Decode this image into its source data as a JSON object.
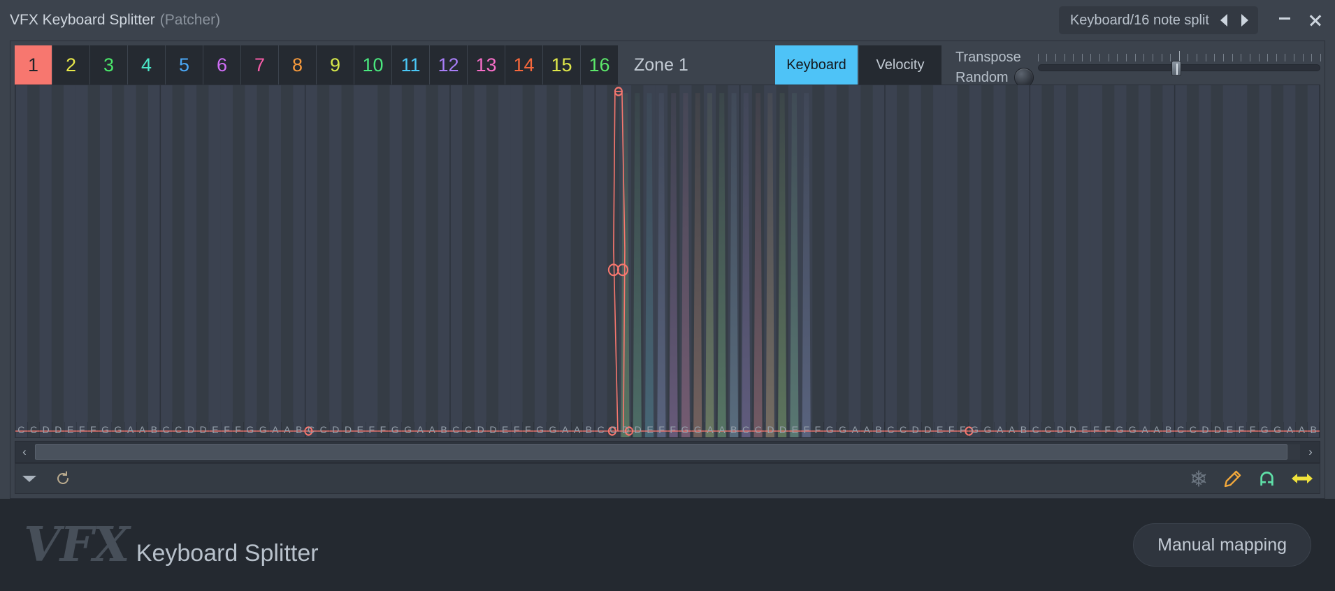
{
  "window": {
    "title": "VFX Keyboard Splitter",
    "title_suffix": "(Patcher)",
    "preset_name": "Keyboard/16 note split",
    "prev_preset_label": "◀",
    "next_preset_label": "▶",
    "minimize_label": "–",
    "close_label": "✕"
  },
  "zones": {
    "label": "Zone 1",
    "active_index": 0,
    "tabs": [
      {
        "label": "1",
        "color": "#20242a"
      },
      {
        "label": "2",
        "color": "#e8e84a"
      },
      {
        "label": "3",
        "color": "#4ae86a"
      },
      {
        "label": "4",
        "color": "#4ae8c8"
      },
      {
        "label": "5",
        "color": "#4aa8f7"
      },
      {
        "label": "6",
        "color": "#d06ef7"
      },
      {
        "label": "7",
        "color": "#f75ca8"
      },
      {
        "label": "8",
        "color": "#f79a3c"
      },
      {
        "label": "9",
        "color": "#d6e84a"
      },
      {
        "label": "10",
        "color": "#4ae87e"
      },
      {
        "label": "11",
        "color": "#4ac8f7"
      },
      {
        "label": "12",
        "color": "#a87ef7"
      },
      {
        "label": "13",
        "color": "#f76ec8"
      },
      {
        "label": "14",
        "color": "#f7683c"
      },
      {
        "label": "15",
        "color": "#e0e84a"
      },
      {
        "label": "16",
        "color": "#5ce86a"
      }
    ]
  },
  "mode": {
    "keyboard_label": "Keyboard",
    "velocity_label": "Velocity",
    "active": "Keyboard",
    "active_color": "#4ec3f7"
  },
  "transpose": {
    "label": "Transpose",
    "random_label": "Random",
    "slider_value_pct": 49,
    "tick_count": 33,
    "major_tick_index": 16
  },
  "grid": {
    "note_labels": [
      "C",
      "C",
      "D",
      "D",
      "E",
      "F",
      "F",
      "G",
      "G",
      "A",
      "A",
      "B"
    ],
    "octave_count": 9,
    "envelope_color": "#f7776f",
    "background_color": "#39404a",
    "zone_band_colors": [
      "#6e9a6e",
      "#5e8f7e",
      "#4f8090",
      "#6e7a9e",
      "#8a6e9e",
      "#9e6e8a",
      "#9e7a6e",
      "#8a9e6e",
      "#6e9e7a",
      "#6e8a9e",
      "#7a6e9e",
      "#9e6e7a",
      "#9e8a6e",
      "#7a9e6e",
      "#6e9e8a",
      "#6e7a9e"
    ]
  },
  "scrollbar": {
    "left_label": "‹",
    "right_label": "›",
    "thumb_pct": 99
  },
  "toolstrip": {
    "menu_label": "▼",
    "reset_label": "↺",
    "icons": [
      {
        "name": "snowflake-icon",
        "color": "#6d7782"
      },
      {
        "name": "pencil-icon",
        "color": "#f3a93c"
      },
      {
        "name": "magnet-icon",
        "color": "#5fe0a8"
      },
      {
        "name": "resize-icon",
        "color": "#f0e23c"
      }
    ]
  },
  "footer": {
    "brand_mark": "VFX",
    "brand_name": "Keyboard Splitter",
    "manual_mapping_label": "Manual mapping"
  }
}
